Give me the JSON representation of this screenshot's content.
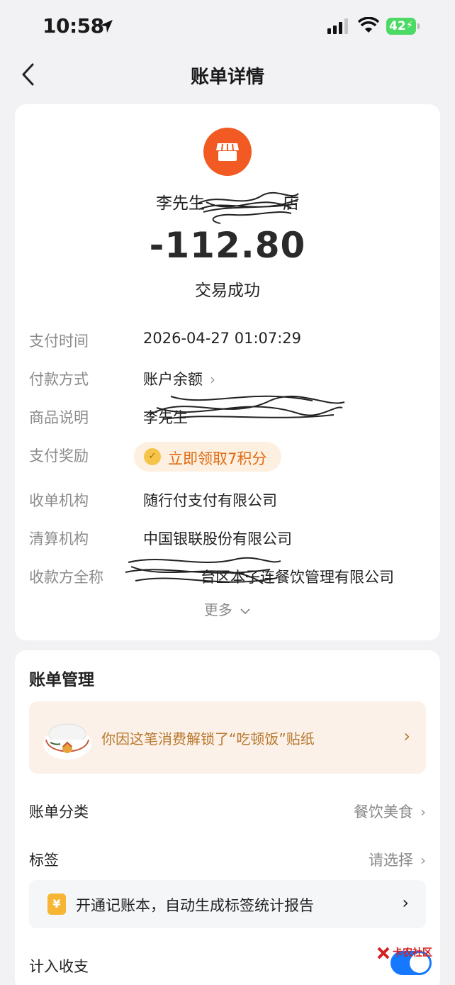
{
  "status_bar": {
    "time": "10:58",
    "battery": "42"
  },
  "nav": {
    "title": "账单详情"
  },
  "bill": {
    "merchant_name": "李先生",
    "merchant_name_tail": "店",
    "amount": "-112.80",
    "status": "交易成功",
    "rows": {
      "pay_time": {
        "label": "支付时间",
        "value": "2026-04-27 01:07:29"
      },
      "pay_method": {
        "label": "付款方式",
        "value": "账户余额"
      },
      "goods_desc": {
        "label": "商品说明",
        "value": "李先生"
      },
      "reward": {
        "label": "支付奖励",
        "value": "立即领取7积分"
      },
      "acquirer": {
        "label": "收单机构",
        "value": "随行付支付有限公司"
      },
      "clearing": {
        "label": "清算机构",
        "value": "中国银联股份有限公司"
      },
      "payee": {
        "label": "收款方全称",
        "value": "台区本子连餐饮管理有限公司"
      }
    },
    "more": "更多"
  },
  "management": {
    "title": "账单管理",
    "sticker_text": "你因这笔消费解锁了“吃顿饭”贴纸",
    "category": {
      "label": "账单分类",
      "value": "餐饮美食"
    },
    "tags": {
      "label": "标签",
      "value": "请选择"
    },
    "notebook": {
      "icon": "¥",
      "text": "开通记账本，自动生成标签统计报告"
    },
    "income_expense": {
      "label": "计入收支"
    }
  },
  "watermark": {
    "text": "卡农社区"
  },
  "icons": {
    "back": "chevron-left-icon",
    "merchant": "store-icon",
    "reward": "coin-icon",
    "notebook": "ledger-icon"
  },
  "colors": {
    "merchant_icon": "#f15a22",
    "reward_text": "#e06a12",
    "sticker_text": "#b8782e",
    "toggle_on": "#1677ff"
  }
}
